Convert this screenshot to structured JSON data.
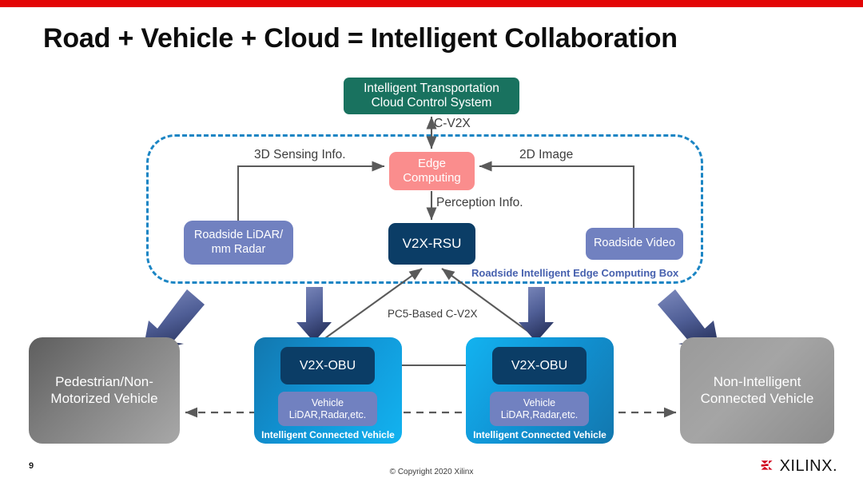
{
  "slide": {
    "title": "Road + Vehicle + Cloud = Intelligent Collaboration",
    "accent_color": "#E30404"
  },
  "diagram": {
    "cloud": {
      "label": "Intelligent Transportation\nCloud Control System",
      "line1": "Intelligent Transportation",
      "line2": "Cloud Control System",
      "color": "#19725F"
    },
    "edge_computing": {
      "line1": "Edge",
      "line2": "Computing",
      "color": "#FA8D8D"
    },
    "roadside_lidar": {
      "line1": "Roadside LiDAR/",
      "line2": "mm Radar",
      "color": "#7181C0"
    },
    "v2x_rsu": {
      "label": "V2X-RSU",
      "color": "#0B3D66"
    },
    "roadside_video": {
      "label": "Roadside Video",
      "color": "#7181C0"
    },
    "edge_box_label": "Roadside Intelligent Edge Computing Box",
    "edge_box_color": "#1B85C4",
    "wire_labels": {
      "c_v2x": "C-V2X",
      "sensing_3d": "3D Sensing Info.",
      "image_2d": "2D Image",
      "perception": "Perception Info.",
      "pc5": "PC5-Based C-V2X"
    },
    "pedestrian": {
      "line1": "Pedestrian/Non-",
      "line2": "Motorized Vehicle",
      "color": "#7E7E7E"
    },
    "non_intelligent": {
      "line1": "Non-Intelligent",
      "line2": "Connected Vehicle",
      "color": "#A5A5A5"
    },
    "vehicles": [
      {
        "obu": "V2X-OBU",
        "sensor_line1": "Vehicle",
        "sensor_line2": "LiDAR,Radar,etc.",
        "caption": "Intelligent Connected Vehicle",
        "color": "#1193D4"
      },
      {
        "obu": "V2X-OBU",
        "sensor_line1": "Vehicle",
        "sensor_line2": "LiDAR,Radar,etc.",
        "caption": "Intelligent Connected Vehicle",
        "color": "#1193D4"
      }
    ]
  },
  "footer": {
    "page_number": "9",
    "copyright": "© Copyright 2020 Xilinx",
    "logo_text": "XILINX.",
    "logo_mark_color": "#D0021B"
  }
}
